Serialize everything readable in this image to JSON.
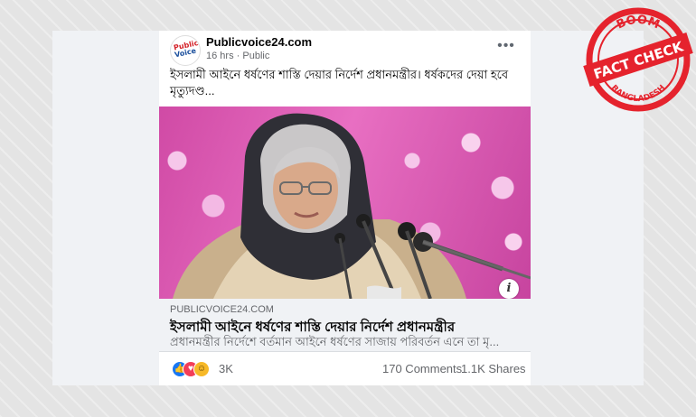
{
  "post": {
    "page_name": "Publicvoice24.com",
    "time": "16 hrs",
    "separator": "·",
    "audience": "Public",
    "text": "ইসলামী আইনে ধর্ষণের শাস্তি দেয়ার নির্দেশ প্রধানমন্ত্রীর। ধর্ষকদের দেয়া হবে মৃত্যুদণ্ড...",
    "avatar_logo": {
      "top": "Public",
      "bottom": "Voice"
    }
  },
  "link": {
    "domain": "PUBLICVOICE24.COM",
    "title": "ইসলামী আইনে ধর্ষণের শাস্তি দেয়ার নির্দেশ প্রধানমন্ত্রীর",
    "description": "প্রধানমন্ত্রীর নির্দেশে বর্তমান আইনে ধর্ষণের সাজায় পরিবর্তন এনে তা মৃ..."
  },
  "engagement": {
    "reaction_count": "3K",
    "comments": "170 Comments",
    "shares": "1.1K Shares",
    "reaction_icons": [
      "like-icon",
      "love-icon",
      "haha-icon"
    ]
  },
  "stamp": {
    "brand": "BOOM",
    "label": "FACT CHECK",
    "region": "BANGLADESH",
    "color": "#e5232d"
  },
  "icons": {
    "more": "more-options-icon",
    "info": "info-icon"
  }
}
